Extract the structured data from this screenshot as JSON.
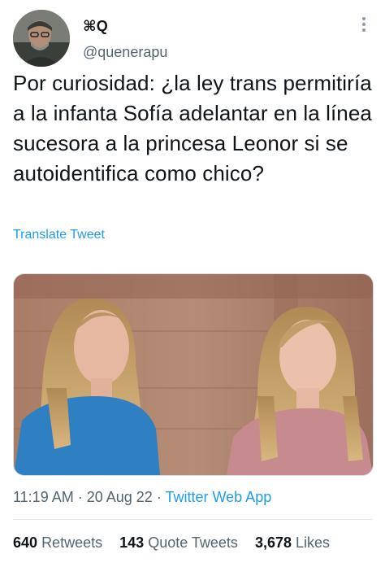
{
  "author": {
    "display_name": "⌘Q",
    "handle": "@quenerapu"
  },
  "tweet": {
    "text": "Por curiosidad: ¿la ley trans permitiría a la infanta Sofía adelantar en la línea sucesora a la princesa Leonor si se autoidentifica como chico?",
    "translate_label": "Translate Tweet"
  },
  "meta": {
    "time": "11:19 AM",
    "separator1": " · ",
    "date": "20 Aug 22",
    "separator2": " · ",
    "source": "Twitter Web App"
  },
  "stats": {
    "retweets_count": "640",
    "retweets_label": "Retweets",
    "quotes_count": "143",
    "quotes_label": "Quote Tweets",
    "likes_count": "3,678",
    "likes_label": "Likes"
  },
  "icons": {
    "more": "more-vertical-icon"
  },
  "colors": {
    "link": "#1d9bf0",
    "secondary_text": "#536471",
    "primary_text": "#0f1419"
  }
}
